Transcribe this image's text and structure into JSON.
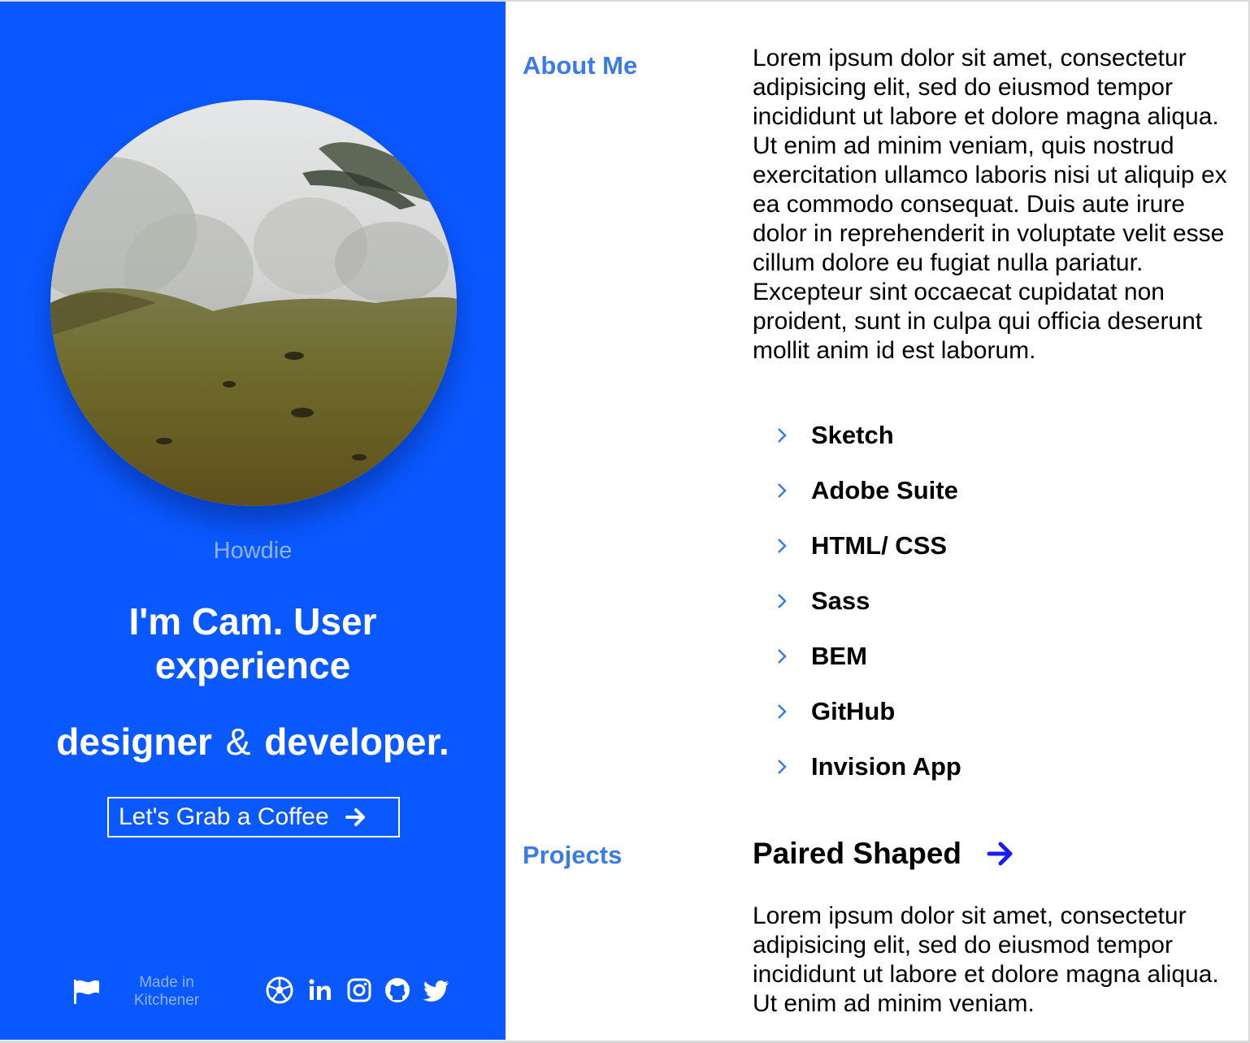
{
  "profile": {
    "greeting": "Howdie",
    "headline_line1": "I'm Cam. User experience",
    "headline_role_a": "designer",
    "headline_amp": "&",
    "headline_role_b": "developer.",
    "cta_label": "Let's Grab a Coffee",
    "photo_alt": "misty meadow"
  },
  "footer": {
    "made_in": "Made in Kitchener",
    "flag_icon": "flag-icon",
    "social_icons": [
      "soccer-ball-icon",
      "linkedin-icon",
      "instagram-icon",
      "github-icon",
      "twitter-icon"
    ]
  },
  "about": {
    "label": "About Me",
    "text": "Lorem ipsum dolor sit amet, consectetur adipisicing elit, sed do eiusmod tempor incididunt ut labore et dolore magna aliqua. Ut enim ad minim veniam, quis nostrud exercitation ullamco laboris nisi ut aliquip ex ea commodo consequat. Duis aute irure dolor in reprehenderit in voluptate velit esse cillum dolore eu fugiat nulla pariatur. Excepteur sint occaecat cupidatat non proident, sunt in culpa qui officia deserunt mollit anim id est laborum.",
    "skills": [
      "Sketch",
      "Adobe Suite",
      "HTML/ CSS",
      "Sass",
      "BEM",
      "GitHub",
      "Invision App"
    ]
  },
  "projects": {
    "label": "Projects",
    "title": "Paired Shaped",
    "text": "Lorem ipsum dolor sit amet, consectetur adipisicing elit, sed do eiusmod tempor incididunt ut labore et dolore magna aliqua. Ut enim ad minim veniam."
  },
  "colors": {
    "panel_blue": "#0a58ff",
    "label_blue": "#3a7be8",
    "muted_blue": "#8fb2ff",
    "arrow_blue": "#1a1aff"
  }
}
